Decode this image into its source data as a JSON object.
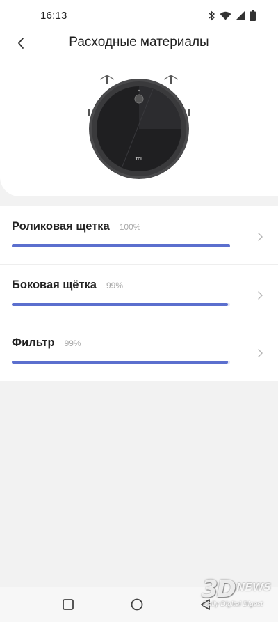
{
  "status_bar": {
    "time": "16:13",
    "icons": [
      "bluetooth-icon",
      "wifi-icon",
      "cellular-signal-icon",
      "battery-icon"
    ]
  },
  "header": {
    "title": "Расходные материалы",
    "back_icon": "chevron-left-icon"
  },
  "device": {
    "brand_label": "TCL",
    "body_color": "#2e2e30"
  },
  "consumables": [
    {
      "name": "Роликовая щетка",
      "percent_label": "100%",
      "level": 1.0
    },
    {
      "name": "Боковая щётка",
      "percent_label": "99%",
      "level": 0.99
    },
    {
      "name": "Фильтр",
      "percent_label": "99%",
      "level": 0.99
    }
  ],
  "colors": {
    "accent": "#5b6fce",
    "background": "#f2f2f2",
    "card": "#ffffff"
  },
  "nav_bar": {
    "buttons": [
      "recent-apps-icon",
      "home-icon",
      "back-triangle-icon"
    ]
  },
  "watermark": {
    "logo": "3D",
    "brand": "NEWS",
    "tagline": "Daily Digital Digest"
  }
}
